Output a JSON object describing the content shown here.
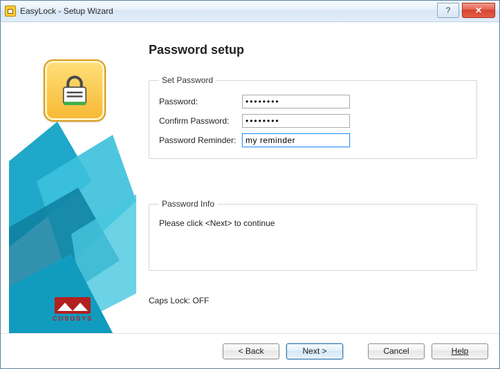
{
  "window": {
    "title": "EasyLock - Setup Wizard"
  },
  "page": {
    "heading": "Password setup"
  },
  "setPassword": {
    "legend": "Set Password",
    "passwordLabel": "Password:",
    "passwordValue": "••••••••",
    "confirmLabel": "Confirm Password:",
    "confirmValue": "••••••••",
    "reminderLabel": "Password Reminder:",
    "reminderValue": "my reminder"
  },
  "passwordInfo": {
    "legend": "Password Info",
    "message": "Please click <Next> to continue"
  },
  "status": {
    "capsLock": "Caps Lock: OFF"
  },
  "brand": {
    "name": "COSOSYS"
  },
  "buttons": {
    "back": "< Back",
    "next": "Next >",
    "cancel": "Cancel",
    "help": "Help"
  }
}
